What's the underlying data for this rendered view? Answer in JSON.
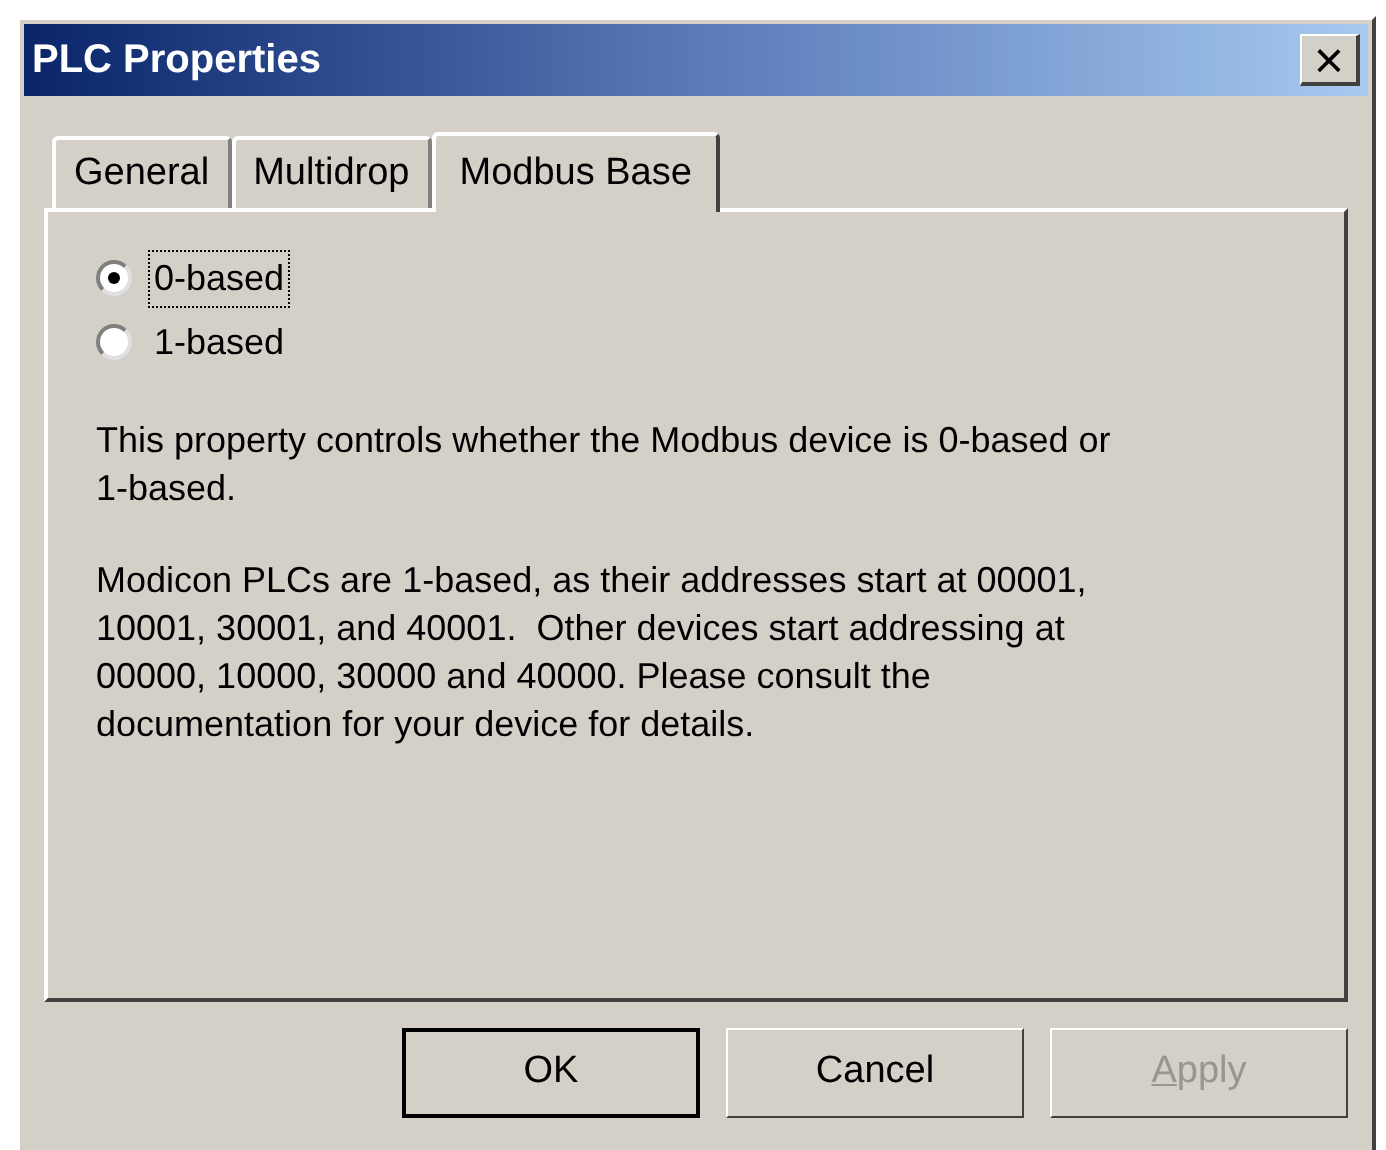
{
  "window": {
    "title": "PLC Properties",
    "close": "×"
  },
  "tabs": [
    {
      "label": "General",
      "selected": false
    },
    {
      "label": "Multidrop",
      "selected": false
    },
    {
      "label": "Modbus Base",
      "selected": true
    }
  ],
  "options": [
    {
      "label": "0-based",
      "selected": true
    },
    {
      "label": "1-based",
      "selected": false
    }
  ],
  "paragraphs": [
    "This property controls whether the Modbus device is 0-based or 1-based.",
    "Modicon PLCs are 1-based, as their addresses start at 00001, 10001, 30001, and 40001.  Other devices start addressing at 00000, 10000, 30000 and 40000. Please consult the documentation for your device for details."
  ],
  "buttons": [
    {
      "label": "OK",
      "disabled": false,
      "default": true
    },
    {
      "label": "Cancel",
      "disabled": false,
      "default": false
    },
    {
      "label": "Apply",
      "disabled": true,
      "default": false
    }
  ]
}
